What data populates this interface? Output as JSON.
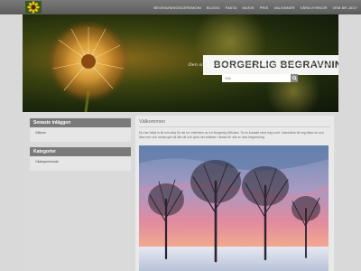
{
  "nav": {
    "items": [
      "Begravningsceremoni",
      "Blogg",
      "Fakta",
      "Musik",
      "Pris",
      "Valsinner",
      "Våra kyrkor",
      "Vem är jag?"
    ]
  },
  "header": {
    "title": "BORGERLIG BEGRAVNING",
    "tagline": "Den sista färden på jorden – Borgerlig begravning i NV Skåne"
  },
  "search": {
    "placeholder": "Sök",
    "icon": "search-icon"
  },
  "sidebar": {
    "recent": {
      "heading": "Senaste inläggen",
      "items": [
        "Välkom"
      ]
    },
    "categories": {
      "heading": "Kategorier",
      "items": [
        "Okategoriserade"
      ]
    }
  },
  "main": {
    "title": "Välkommen",
    "text": "Du har hittat in till min sida för att se i närheten av en Borgerlig Officiant. Ta en kontakt med mig nu/el. Namnlänk till mig hittar du och läsa mer och sedan gör så lätt väl och göra det enklare i dessa för alla er utav begravning."
  },
  "colors": {
    "topbar": "#666666",
    "background": "#d9d9d9",
    "widget_header": "#7a7a7a",
    "title_box": "#ffffff"
  }
}
